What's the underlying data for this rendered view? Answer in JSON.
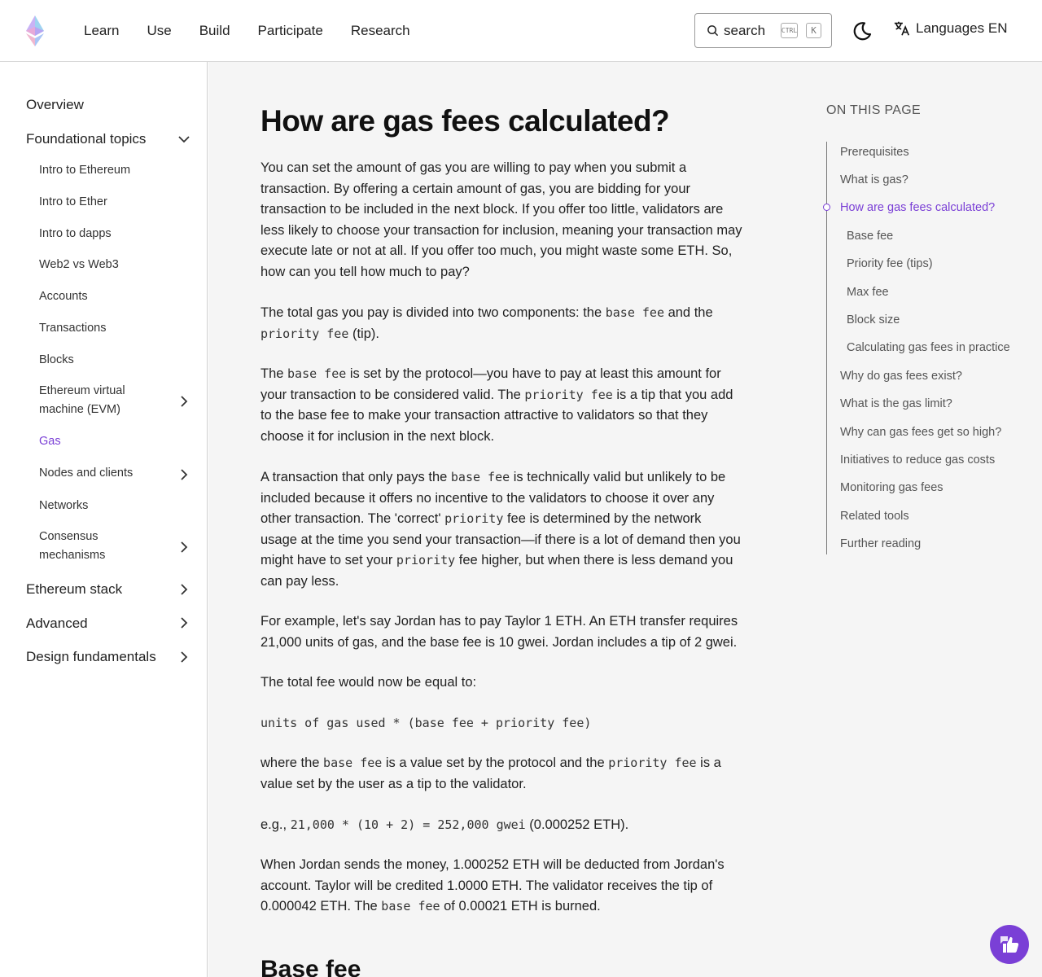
{
  "header": {
    "nav": [
      "Learn",
      "Use",
      "Build",
      "Participate",
      "Research"
    ],
    "search_label": "search",
    "kbd_ctrl": "CTRL",
    "kbd_k": "K",
    "languages_label": "Languages EN"
  },
  "sidebar": {
    "overview": "Overview",
    "foundational": "Foundational topics",
    "sub": [
      "Intro to Ethereum",
      "Intro to Ether",
      "Intro to dapps",
      "Web2 vs Web3",
      "Accounts",
      "Transactions",
      "Blocks"
    ],
    "evm_line1": "Ethereum virtual",
    "evm_line2": "machine (EVM)",
    "gas": "Gas",
    "nodes": "Nodes and clients",
    "networks": "Networks",
    "consensus_line1": "Consensus",
    "consensus_line2": "mechanisms",
    "stack": "Ethereum stack",
    "advanced": "Advanced",
    "design": "Design fundamentals"
  },
  "main": {
    "title": "How are gas fees calculated?",
    "p1": [
      "You can set the amount of gas you are willing to pay when you submit a",
      "transaction. By offering a certain amount of gas, you are bidding for your",
      "transaction to be included in the next block. If you offer too little, validators are",
      "less likely to choose your transaction for inclusion, meaning your transaction may",
      "execute late or not at all. If you offer too much, you might waste some ETH. So,",
      "how can you tell how much to pay?"
    ],
    "p2a": "The total gas you pay is divided into two components: the ",
    "p2b": "base fee",
    "p2c": " and the",
    "p2d": "priority fee",
    "p2e": " (tip).",
    "p3a": "The ",
    "p3b": "base fee",
    "p3c": " is set by the protocol—you have to pay at least this amount for",
    "p3d": "your transaction to be considered valid. The ",
    "p3e": "priority fee",
    "p3f": " is a tip that you add",
    "p3g": "to the base fee to make your transaction attractive to validators so that they",
    "p3h": "choose it for inclusion in the next block.",
    "p4a": "A transaction that only pays the ",
    "p4b": "base fee",
    "p4c": " is technically valid but unlikely to be",
    "p4d": "included because it offers no incentive to the validators to choose it over any",
    "p4e": "other transaction. The 'correct' ",
    "p4f": "priority",
    "p4g": " fee is determined by the network",
    "p4h": "usage at the time you send your transaction—if there is a lot of demand then you",
    "p4i": "might have to set your ",
    "p4j": "priority",
    "p4k": " fee higher, but when there is less demand you",
    "p4l": "can pay less.",
    "p5": [
      "For example, let's say Jordan has to pay Taylor 1 ETH. An ETH transfer requires",
      "21,000 units of gas, and the base fee is 10 gwei. Jordan includes a tip of 2 gwei."
    ],
    "p6": "The total fee would now be equal to:",
    "formula": "units of gas used * (base fee + priority fee)",
    "p7a": "where the ",
    "p7b": "base fee",
    "p7c": " is a value set by the protocol and the ",
    "p7d": "priority fee",
    "p7e": " is a",
    "p7f": "value set by the user as a tip to the validator.",
    "p8a": "e.g., ",
    "p8b": "21,000 * (10 + 2) = 252,000 gwei",
    "p8c": " (0.000252 ETH).",
    "p9a": "When Jordan sends the money, 1.000252 ETH will be deducted from Jordan's",
    "p9b": "account. Taylor will be credited 1.0000 ETH. The validator receives the tip of",
    "p9c": "0.000042 ETH. The ",
    "p9d": "base fee",
    "p9e": " of 0.00021 ETH is burned.",
    "h2": "Base fee"
  },
  "toc": {
    "title": "ON THIS PAGE",
    "items": [
      "Prerequisites",
      "What is gas?",
      "How are gas fees calculated?",
      "Base fee",
      "Priority fee (tips)",
      "Max fee",
      "Block size",
      "Calculating gas fees in practice",
      "Why do gas fees exist?",
      "What is the gas limit?",
      "Why can gas fees get so high?",
      "Initiatives to reduce gas costs",
      "Monitoring gas fees",
      "Related tools",
      "Further reading"
    ]
  },
  "colors": {
    "accent": "#7a3fd6"
  }
}
